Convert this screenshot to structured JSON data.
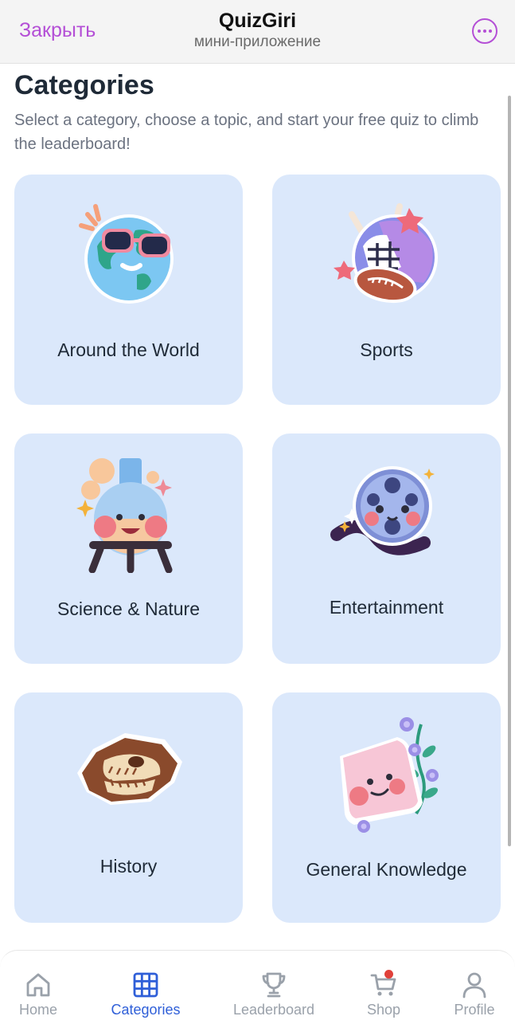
{
  "header": {
    "close_label": "Закрыть",
    "title": "QuizGiri",
    "subtitle": "мини-приложение",
    "more_icon": "more-dots-icon"
  },
  "main": {
    "title": "Categories",
    "description": "Select a category, choose a topic, and start your free quiz to climb the leaderboard!"
  },
  "categories": [
    {
      "label": "Around the World",
      "icon": "globe-sunglasses-icon"
    },
    {
      "label": "Sports",
      "icon": "sports-helmet-ball-icon"
    },
    {
      "label": "Science & Nature",
      "icon": "flask-icon"
    },
    {
      "label": "Entertainment",
      "icon": "film-reel-icon"
    },
    {
      "label": "History",
      "icon": "dinosaur-fossil-icon"
    },
    {
      "label": "General Knowledge",
      "icon": "book-flowers-icon"
    }
  ],
  "nav": {
    "items": [
      {
        "label": "Home",
        "icon": "home-icon"
      },
      {
        "label": "Categories",
        "icon": "grid-icon"
      },
      {
        "label": "Leaderboard",
        "icon": "trophy-icon"
      },
      {
        "label": "Shop",
        "icon": "cart-icon"
      },
      {
        "label": "Profile",
        "icon": "user-icon"
      }
    ],
    "active": "Categories"
  },
  "colors": {
    "accent_purple": "#b44fd6",
    "card_bg": "#dbe8fb",
    "nav_active": "#2f5fd8",
    "nav_inactive": "#9aa1aa",
    "badge_red": "#e0413a"
  }
}
